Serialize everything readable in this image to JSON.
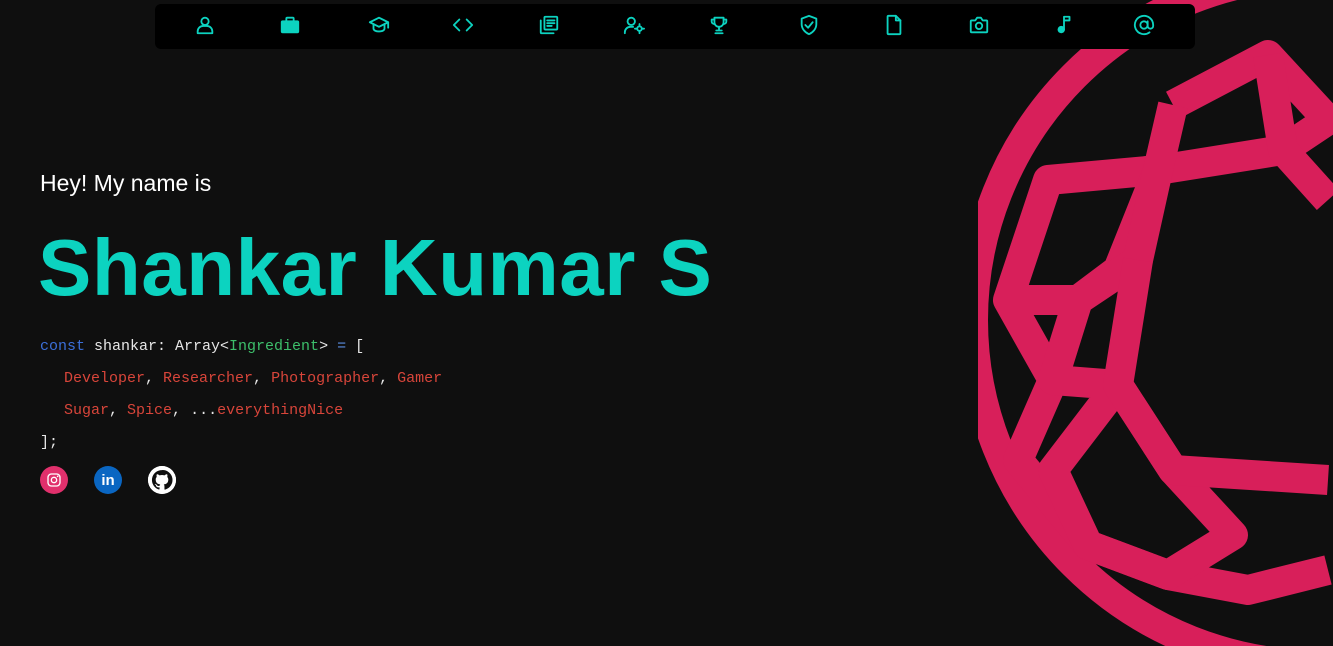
{
  "nav": {
    "items": [
      {
        "icon": "person-icon",
        "name": "nav-about"
      },
      {
        "icon": "briefcase-icon",
        "name": "nav-experience"
      },
      {
        "icon": "graduation-cap-icon",
        "name": "nav-education"
      },
      {
        "icon": "code-icon",
        "name": "nav-projects"
      },
      {
        "icon": "library-books-icon",
        "name": "nav-publications"
      },
      {
        "icon": "person-settings-icon",
        "name": "nav-skills"
      },
      {
        "icon": "trophy-icon",
        "name": "nav-achievements"
      },
      {
        "icon": "verified-shield-icon",
        "name": "nav-certifications"
      },
      {
        "icon": "document-icon",
        "name": "nav-resume"
      },
      {
        "icon": "camera-icon",
        "name": "nav-photography"
      },
      {
        "icon": "music-note-icon",
        "name": "nav-music"
      },
      {
        "icon": "at-sign-icon",
        "name": "nav-contact"
      }
    ],
    "icon_color": "#0cd3c0"
  },
  "hero": {
    "greeting": "Hey! My name is",
    "name": "Shankar Kumar S"
  },
  "code": {
    "line1": {
      "kw": "const",
      "var": " shankar: Array<",
      "type": "Ingredient",
      "close": "> ",
      "eq": "=",
      "bracket": " ["
    },
    "line2": {
      "a": "Developer",
      "b": "Researcher",
      "c": "Photographer",
      "d": "Gamer",
      "sep": ", "
    },
    "line3": {
      "a": "Sugar",
      "b": "Spice",
      "spread": "...",
      "c": "everythingNice",
      "sep": ", "
    },
    "line4": "];"
  },
  "social": {
    "instagram": "instagram-icon",
    "linkedin": "linkedin-icon",
    "linkedin_text": "in",
    "github": "github-icon"
  },
  "colors": {
    "accent": "#0cd3c0",
    "decoration": "#d81f5a",
    "background": "#0f0f0f"
  }
}
